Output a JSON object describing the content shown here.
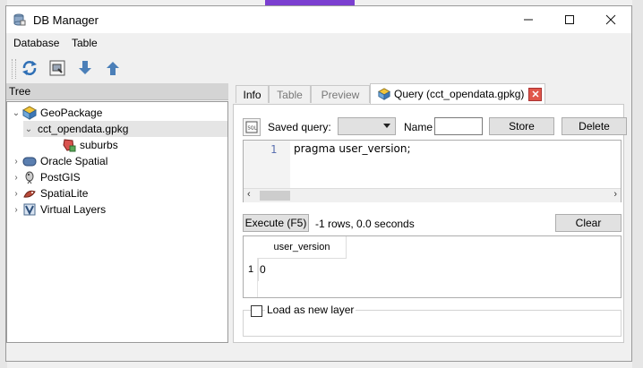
{
  "window": {
    "title": "DB Manager"
  },
  "menu": [
    "Database",
    "Table"
  ],
  "toolbar": {
    "refresh_icon": "refresh-icon",
    "sql_window_icon": "sql-window-icon",
    "import_icon": "import-icon",
    "export_icon": "export-icon"
  },
  "tree": {
    "header": "Tree",
    "items": [
      {
        "label": "GeoPackage",
        "icon": "geopackage-icon",
        "expanded": true
      },
      {
        "label": "cct_opendata.gpkg",
        "icon": "",
        "expanded": true
      },
      {
        "label": "suburbs",
        "icon": "polygon-layer-icon"
      },
      {
        "label": "Oracle Spatial",
        "icon": "oracle-icon",
        "expanded": false
      },
      {
        "label": "PostGIS",
        "icon": "postgis-icon",
        "expanded": false
      },
      {
        "label": "SpatiaLite",
        "icon": "spatialite-icon",
        "expanded": false
      },
      {
        "label": "Virtual Layers",
        "icon": "virtual-layers-icon",
        "expanded": false
      }
    ]
  },
  "tabs": {
    "info": "Info",
    "table": "Table",
    "preview": "Preview",
    "query": "Query (cct_opendata.gpkg)"
  },
  "query": {
    "saved_query_label": "Saved query:",
    "saved_query_value": "",
    "name_label": "Name",
    "name_value": "",
    "store_label": "Store",
    "delete_label": "Delete",
    "line_number": "1",
    "sql": "pragma user_version;",
    "execute_label": "Execute (F5)",
    "status": "-1 rows, 0.0 seconds",
    "clear_label": "Clear",
    "result": {
      "columns": [
        "user_version"
      ],
      "rows": [
        {
          "index": "1",
          "values": [
            "0"
          ]
        }
      ]
    },
    "load_layer_label": "Load as new layer"
  },
  "colors": {
    "selection": "#e5e5e5",
    "close_tab": "#e0574a",
    "accent": "#3c78c8"
  }
}
